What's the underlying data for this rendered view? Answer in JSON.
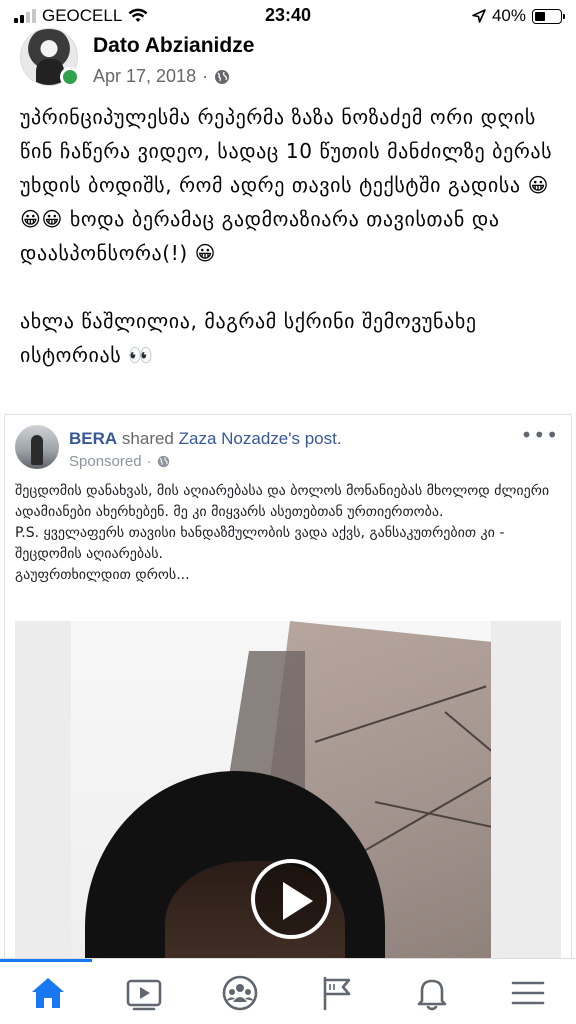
{
  "status_bar": {
    "carrier": "GEOCELL",
    "time": "23:40",
    "battery": "40%",
    "battery_level": 0.4
  },
  "post": {
    "author": "Dato Abzianidze",
    "date": "Apr 17, 2018",
    "separator": "·",
    "paragraph_1": "უპრინციპულესმა რეპერმა ზაზა ნოზაძემ ორი დღის წინ ჩაწერა ვიდეო, სადაც 10 წუთის მანძილზე ბერას უხდის ბოდიშს, რომ ადრე თავის ტექსტში გადისა 😀😀😀 ხოდა ბერამაც გადმოაზიარა თავისთან და დაასპონსორა(!) 😀",
    "paragraph_2": "ახლა წაშლილია, მაგრამ სქრინი შემოვუნახე ისტორიას 👀"
  },
  "shared": {
    "page_name": "BERA",
    "shared_text": "shared",
    "original_author": "Zaza Nozadze's post.",
    "sponsored": "Sponsored",
    "separator": "·",
    "more": "•••",
    "text_line_1": "შეცდომის დანახვას, მის აღიარებასა და ბოლოს მონანიებას მხოლოდ ძლიერი ადამიანები ახერხებენ. მე კი მიყვარს ასეთებთან ურთიერთობა.",
    "text_line_2": "P.S. ყველაფერს თავისი ხანდაზმულობის ვადა აქვს, განსაკუთრებით კი - შეცდომის აღიარებას.",
    "text_line_3": "გაუფრთხილდით დროს..."
  },
  "bottom_nav": {
    "items": [
      "home-icon",
      "watch-icon",
      "groups-icon",
      "pages-flag-icon",
      "notifications-bell-icon",
      "menu-icon"
    ],
    "active": "home-icon",
    "accent": "#1877f2"
  }
}
